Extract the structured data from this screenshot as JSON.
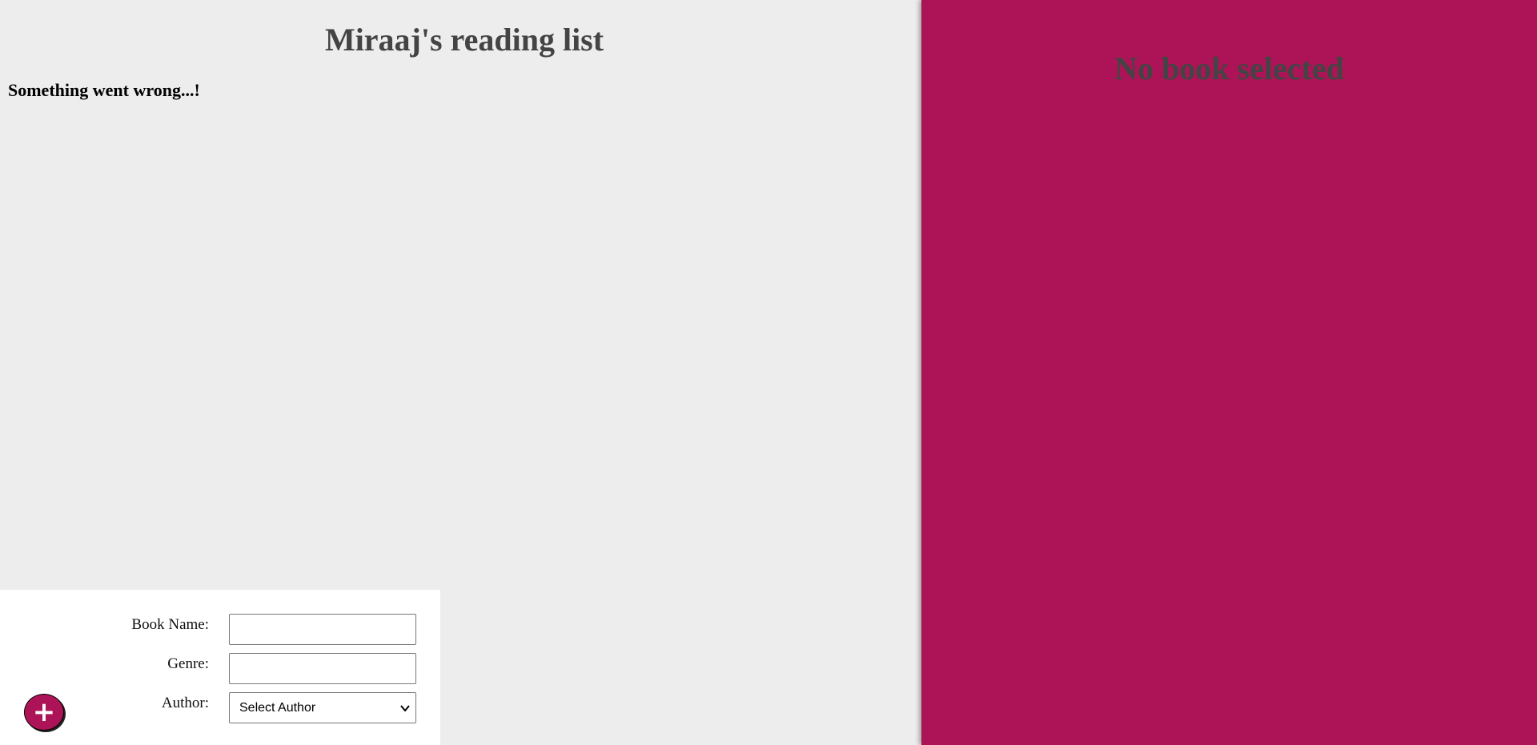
{
  "main": {
    "title": "Miraaj's reading list",
    "error_message": "Something went wrong...!"
  },
  "detail_panel": {
    "heading": "No book selected",
    "background_color": "#ad1457"
  },
  "form": {
    "book_name_label": "Book Name:",
    "book_name_value": "",
    "genre_label": "Genre:",
    "genre_value": "",
    "author_label": "Author:",
    "author_selected": "Select Author"
  },
  "add_button": {
    "symbol": "+",
    "icon": "plus-icon"
  }
}
